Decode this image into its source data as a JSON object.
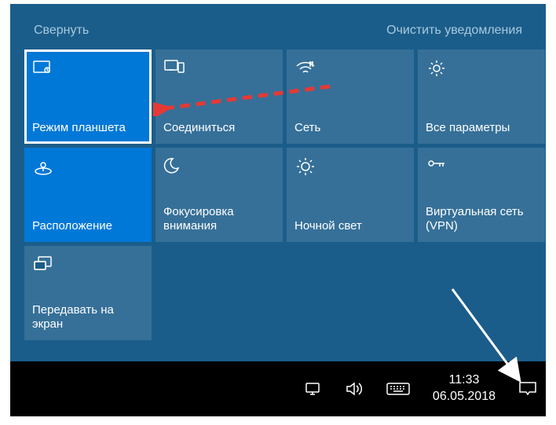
{
  "header": {
    "collapse": "Свернуть",
    "clear": "Очистить уведомления"
  },
  "tiles": [
    {
      "id": "tablet-mode",
      "label": "Режим планшета",
      "icon": "tablet-icon",
      "active": true,
      "selected": true
    },
    {
      "id": "connect",
      "label": "Соединиться",
      "icon": "connect-icon",
      "active": false,
      "selected": false
    },
    {
      "id": "network",
      "label": "Сеть",
      "icon": "wifi-icon",
      "active": false,
      "selected": false
    },
    {
      "id": "all-settings",
      "label": "Все параметры",
      "icon": "gear-icon",
      "active": false,
      "selected": false
    },
    {
      "id": "location",
      "label": "Расположение",
      "icon": "location-icon",
      "active": true,
      "selected": false
    },
    {
      "id": "focus-assist",
      "label": "Фокусировка внимания",
      "icon": "moon-icon",
      "active": false,
      "selected": false
    },
    {
      "id": "night-light",
      "label": "Ночной свет",
      "icon": "sun-icon",
      "active": false,
      "selected": false
    },
    {
      "id": "vpn",
      "label": "Виртуальная сеть (VPN)",
      "icon": "vpn-icon",
      "active": false,
      "selected": false
    },
    {
      "id": "project",
      "label": "Передавать на экран",
      "icon": "project-icon",
      "active": false,
      "selected": false
    }
  ],
  "taskbar": {
    "time": "11:33",
    "date": "06.05.2018"
  }
}
